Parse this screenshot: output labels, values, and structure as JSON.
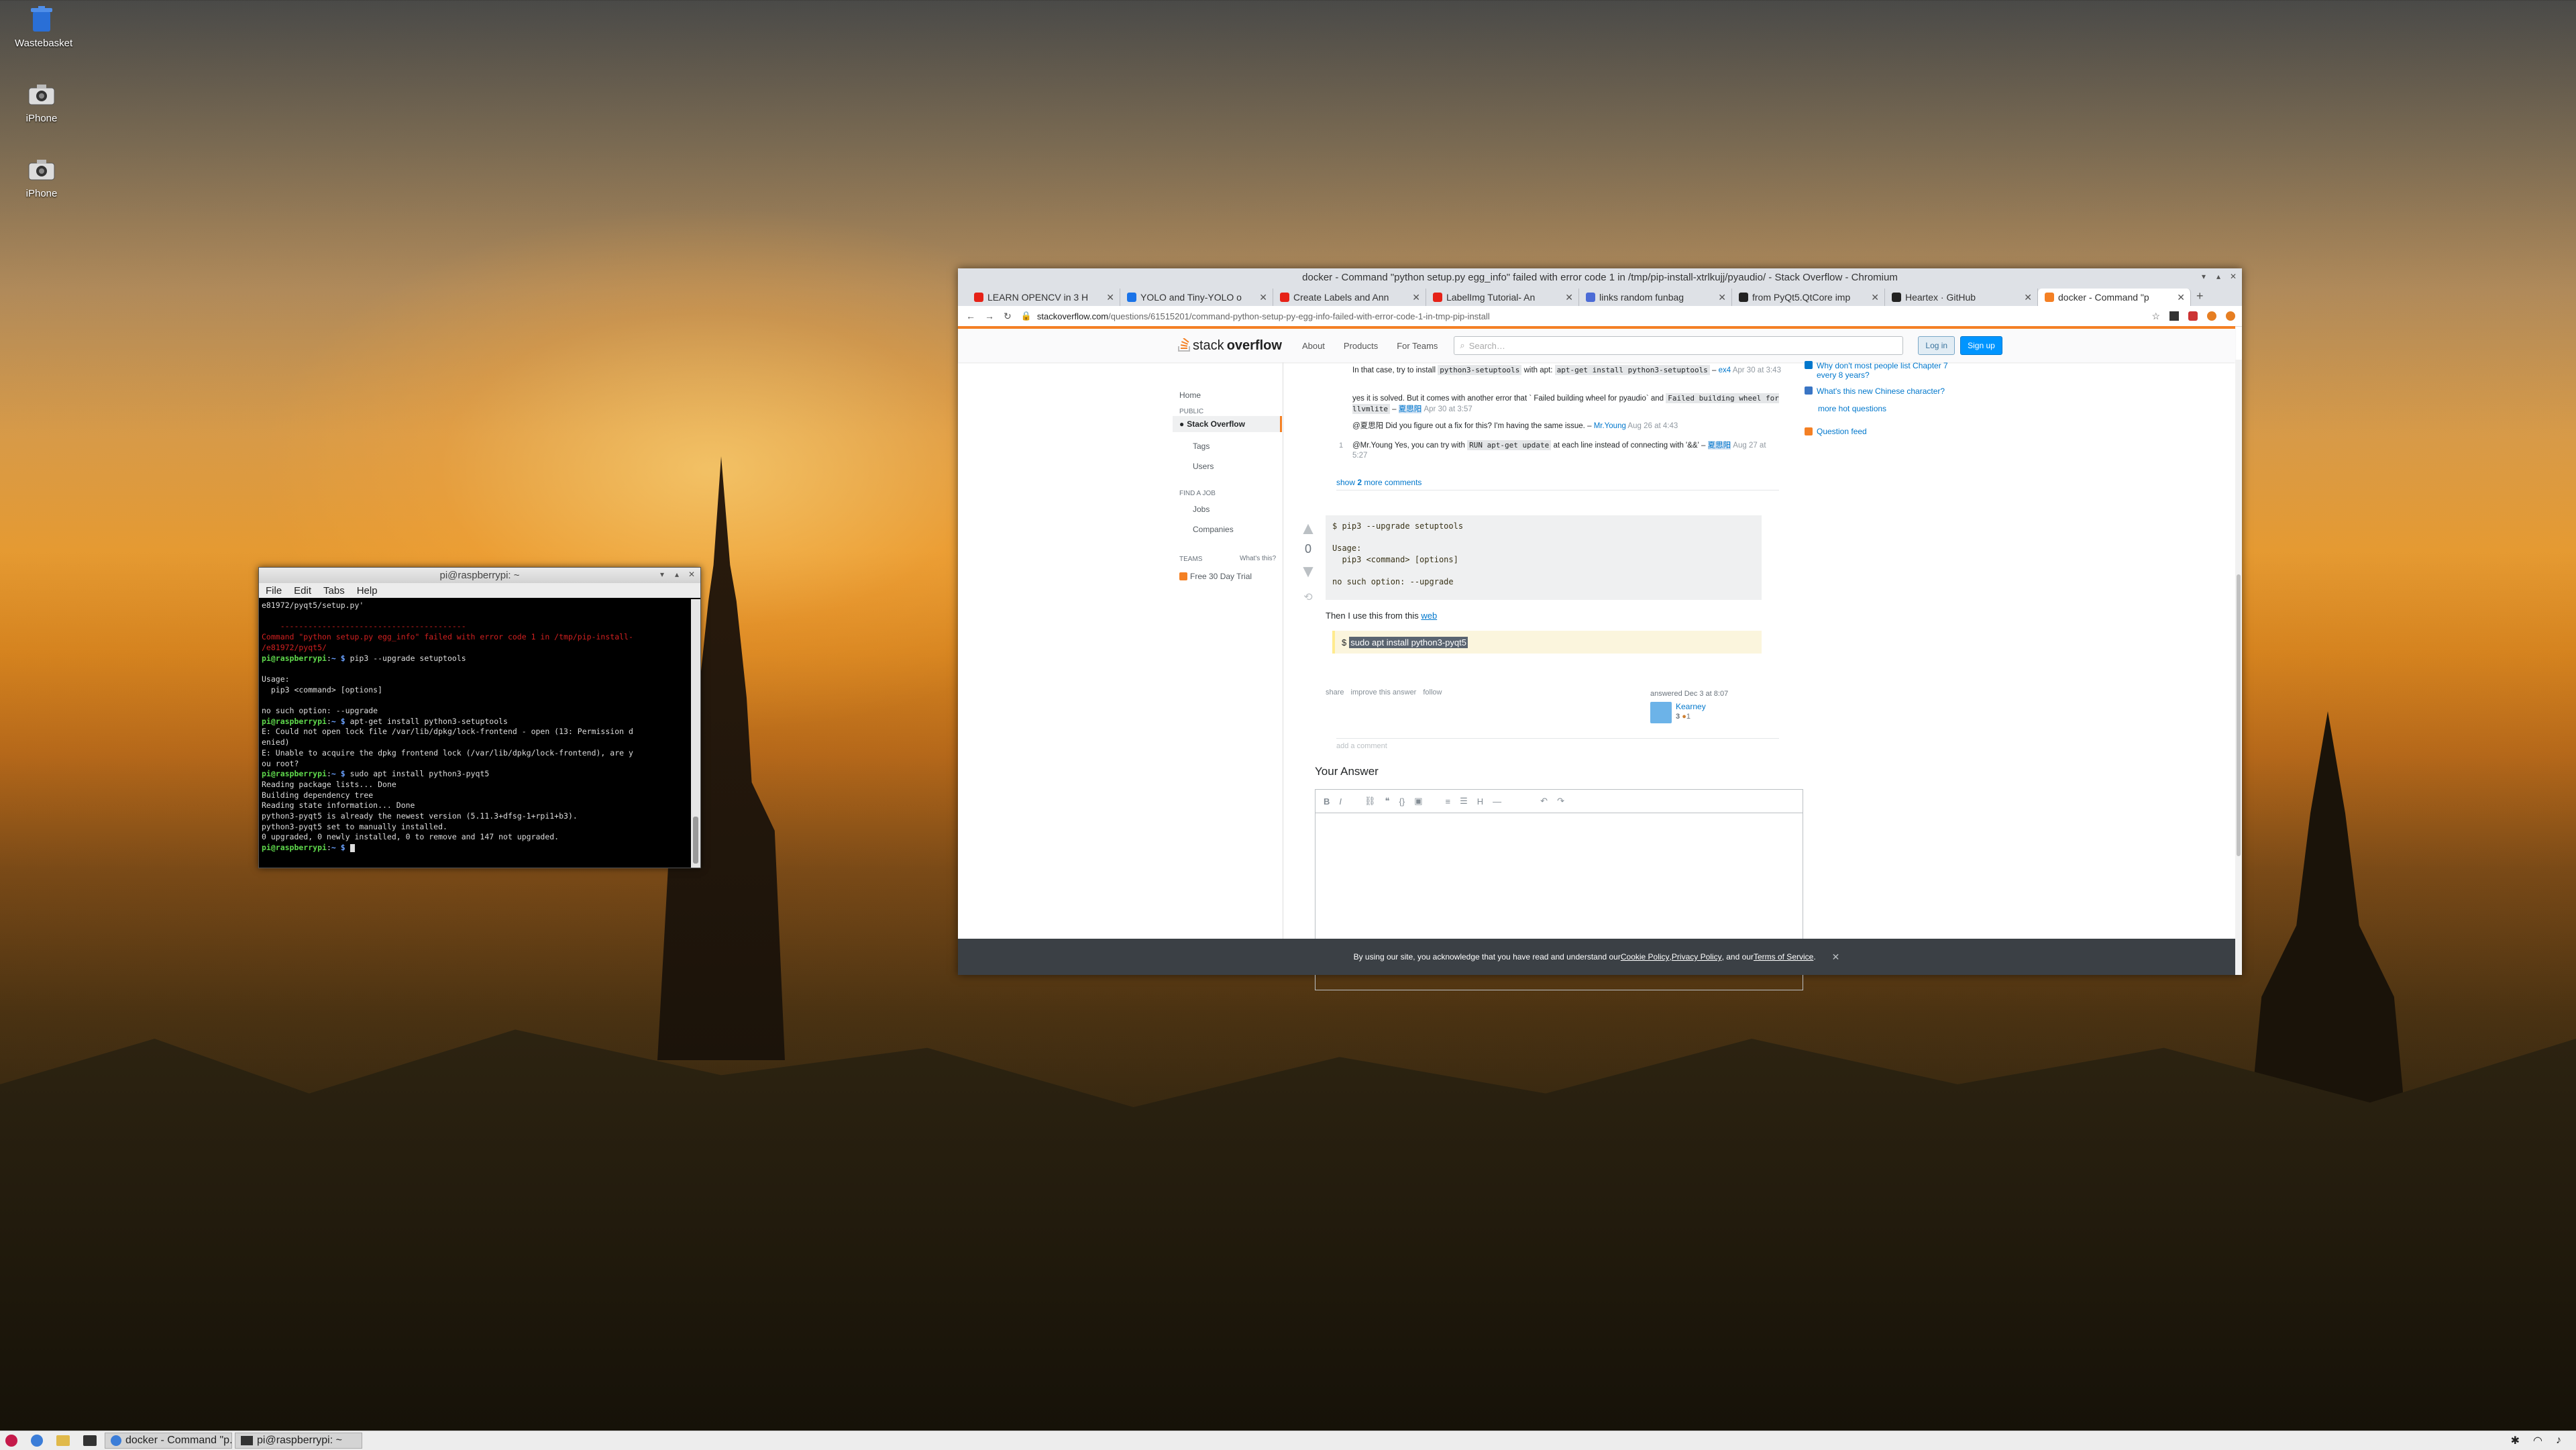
{
  "desktop": {
    "icons": [
      {
        "label": "Wastebasket",
        "icon": "trash-icon"
      },
      {
        "label": "iPhone",
        "icon": "camera-icon"
      },
      {
        "label": "iPhone",
        "icon": "camera-icon"
      }
    ]
  },
  "terminal": {
    "title": "pi@raspberrypi: ~",
    "menu": [
      "File",
      "Edit",
      "Tabs",
      "Help"
    ],
    "lines": [
      {
        "t": "e81972/pyqt5/setup.py'",
        "c": ""
      },
      {
        "t": "",
        "c": ""
      },
      {
        "t": "    ----------------------------------------",
        "c": "r"
      },
      {
        "t": "Command \"python setup.py egg_info\" failed with error code 1 in /tmp/pip-install-",
        "c": "r"
      },
      {
        "t": "/e81972/pyqt5/",
        "c": "r"
      },
      {
        "t": "pi@raspberrypi:~ $ pip3 --upgrade setuptools",
        "c": "prompt"
      },
      {
        "t": "",
        "c": ""
      },
      {
        "t": "Usage:",
        "c": ""
      },
      {
        "t": "  pip3 <command> [options]",
        "c": ""
      },
      {
        "t": "",
        "c": ""
      },
      {
        "t": "no such option: --upgrade",
        "c": ""
      },
      {
        "t": "pi@raspberrypi:~ $ apt-get install python3-setuptools",
        "c": "prompt"
      },
      {
        "t": "E: Could not open lock file /var/lib/dpkg/lock-frontend - open (13: Permission d",
        "c": ""
      },
      {
        "t": "enied)",
        "c": ""
      },
      {
        "t": "E: Unable to acquire the dpkg frontend lock (/var/lib/dpkg/lock-frontend), are y",
        "c": ""
      },
      {
        "t": "ou root?",
        "c": ""
      },
      {
        "t": "pi@raspberrypi:~ $ sudo apt install python3-pyqt5",
        "c": "prompt"
      },
      {
        "t": "Reading package lists... Done",
        "c": ""
      },
      {
        "t": "Building dependency tree",
        "c": ""
      },
      {
        "t": "Reading state information... Done",
        "c": ""
      },
      {
        "t": "python3-pyqt5 is already the newest version (5.11.3+dfsg-1+rpi1+b3).",
        "c": ""
      },
      {
        "t": "python3-pyqt5 set to manually installed.",
        "c": ""
      },
      {
        "t": "0 upgraded, 0 newly installed, 0 to remove and 147 not upgraded.",
        "c": ""
      },
      {
        "t": "pi@raspberrypi:~ $ ",
        "c": "prompt"
      }
    ]
  },
  "browser": {
    "title": "docker - Command \"python setup.py egg_info\" failed with error code 1 in /tmp/pip-install-xtrlkujj/pyaudio/ - Stack Overflow - Chromium",
    "tabs": [
      {
        "label": "LEARN OPENCV in 3 H",
        "color": "#e62117"
      },
      {
        "label": "YOLO and Tiny-YOLO o",
        "color": "#1a73e8"
      },
      {
        "label": "Create Labels and Ann",
        "color": "#e62117"
      },
      {
        "label": "LabelImg Tutorial- An",
        "color": "#e62117"
      },
      {
        "label": "links random funbag",
        "color": "#4b6bd6"
      },
      {
        "label": "from PyQt5.QtCore imp",
        "color": "#222222"
      },
      {
        "label": "Heartex · GitHub",
        "color": "#222222"
      },
      {
        "label": "docker - Command \"p",
        "color": "#f48024"
      }
    ],
    "url_host": "stackoverflow.com",
    "url_path": "/questions/61515201/command-python-setup-py-egg-info-failed-with-error-code-1-in-tmp-pip-install",
    "so": {
      "logo_plain": "stack",
      "logo_bold": "overflow",
      "nav": [
        "About",
        "Products",
        "For Teams"
      ],
      "search_placeholder": "Search…",
      "login": "Log in",
      "signup": "Sign up",
      "left": {
        "home": "Home",
        "public": "PUBLIC",
        "stackoverflow": "Stack Overflow",
        "tags": "Tags",
        "users": "Users",
        "find_job": "FIND A JOB",
        "jobs": "Jobs",
        "companies": "Companies",
        "teams": "TEAMS",
        "whats_this": "What's this?",
        "trial": "Free 30 Day Trial"
      },
      "comments": [
        {
          "pre": "In that case, try to install ",
          "code": "python3-setuptools",
          "mid": " with apt: ",
          "code2": "apt-get install python3-setuptools",
          "post": "",
          "user": "ex4",
          "date": "Apr 30 at 3:43"
        },
        {
          "pre": "yes it is solved. But it comes with another error that ` Failed building wheel for pyaudio` and ",
          "code": "Failed building wheel for llvmlite",
          "mid": "",
          "code2": "",
          "post": "",
          "user": "夏思阳",
          "date": "Apr 30 at 3:57"
        },
        {
          "pre": "@夏思阳 Did you figure out a fix for this? I'm having the same issue.",
          "code": "",
          "mid": "",
          "code2": "",
          "post": "",
          "user": "Mr.Young",
          "date": "Aug 26 at 4:43"
        },
        {
          "pre": "@Mr.Young Yes, you can try with ",
          "code": "RUN apt-get update",
          "mid": " at each line instead of connecting with '&&'",
          "code2": "",
          "post": "",
          "user": "夏思阳",
          "date": "Aug 27 at 5:27"
        }
      ],
      "comment_vote": "1",
      "show_more_pre": "show ",
      "show_more_num": "2",
      "show_more_post": " more comments",
      "answer": {
        "votes": "0",
        "pre": "$ pip3 --upgrade setuptools\n\nUsage:\n  pip3 <command> [options]\n\nno such option: --upgrade",
        "text_pre": "Then I use this from this ",
        "text_link": "web",
        "quote_dollar": "$",
        "quote_sel": "sudo apt install python3-pyqt5",
        "actions": [
          "share",
          "improve this answer",
          "follow"
        ],
        "answered": "answered Dec 3 at 8:07",
        "user": "Kearney",
        "rep": "3",
        "badge": "1",
        "add_comment": "add a comment"
      },
      "your_answer": "Your Answer",
      "sidebar": [
        "Why don't most people list Chapter 7 every 8 years?",
        "What's this new Chinese character?",
        "more hot questions",
        "Question feed"
      ],
      "cookie": {
        "pre": "By using our site, you acknowledge that you have read and understand our ",
        "l1": "Cookie Policy",
        "sep": ", ",
        "l2": "Privacy Policy",
        "and": ", and our ",
        "l3": "Terms of Service",
        "end": "."
      }
    }
  },
  "taskbar": {
    "tasks": [
      "docker - Command \"p...",
      "pi@raspberrypi: ~"
    ]
  }
}
